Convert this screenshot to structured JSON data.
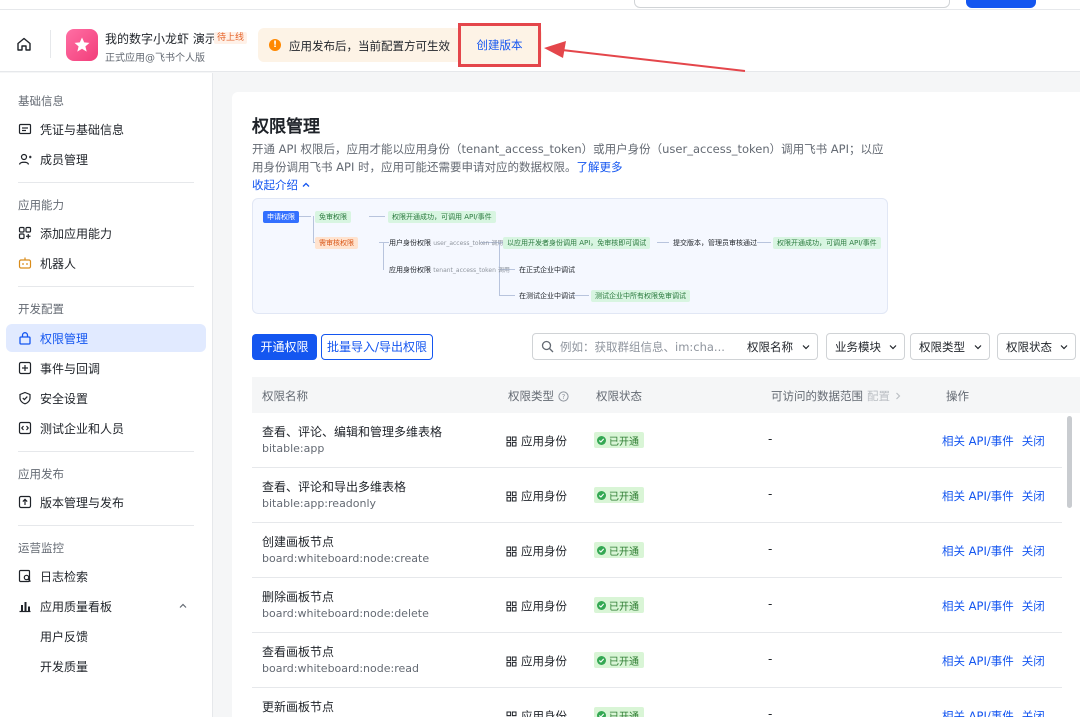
{
  "colors": {
    "accent": "#1456f0",
    "active_bg": "#e1eaff",
    "success": "#34a853",
    "warning": "#ff8800",
    "highlight": "#e4464b"
  },
  "app": {
    "name": "我的数字小龙虾 演示",
    "tag": "待上线",
    "subtitle": "正式应用@飞书个人版"
  },
  "notice": {
    "text": "应用发布后，当前配置方可生效",
    "action_label": "创建版本"
  },
  "sidebar": {
    "sections": [
      {
        "title": "基础信息",
        "items": [
          {
            "label": "凭证与基础信息",
            "icon": "credential-icon"
          },
          {
            "label": "成员管理",
            "icon": "member-icon"
          }
        ]
      },
      {
        "title": "应用能力",
        "items": [
          {
            "label": "添加应用能力",
            "icon": "grid-icon"
          },
          {
            "label": "机器人",
            "icon": "robot-icon"
          }
        ]
      },
      {
        "title": "开发配置",
        "items": [
          {
            "label": "权限管理",
            "icon": "lock-icon"
          },
          {
            "label": "事件与回调",
            "icon": "event-icon"
          },
          {
            "label": "安全设置",
            "icon": "shield-icon"
          },
          {
            "label": "测试企业和人员",
            "icon": "code-icon"
          }
        ]
      },
      {
        "title": "应用发布",
        "items": [
          {
            "label": "版本管理与发布",
            "icon": "upload-icon"
          }
        ]
      },
      {
        "title": "运营监控",
        "items": [
          {
            "label": "日志检索",
            "icon": "log-icon"
          },
          {
            "label": "应用质量看板",
            "icon": "chart-icon"
          },
          {
            "label": "用户反馈",
            "icon": ""
          },
          {
            "label": "开发质量",
            "icon": ""
          }
        ]
      }
    ],
    "active_item": "权限管理"
  },
  "main": {
    "title": "权限管理",
    "intro": "开通 API 权限后，应用才能以应用身份（tenant_access_token）或用户身份（user_access_token）调用飞书 API；以应用身份调用飞书 API 时，应用可能还需要申请对应的数据权限。",
    "learn_more": "了解更多",
    "collapse_label": "收起介绍",
    "diagram": {
      "apply": "申请权限",
      "no_review": "免审权限",
      "no_review_result": "权限开通成功，可调用 API/事件",
      "need_review": "需审核权限",
      "user_identity": "用户身份权限",
      "user_token": "user_access_token 调用",
      "dev_debug": "以应用开发者身份调用 API，免审核即可调试",
      "submit": "提交版本，管理员审核通过",
      "final_result": "权限开通成功，可调用 API/事件",
      "app_identity": "应用身份权限",
      "tenant_token": "tenant_access_token 调用",
      "formal_debug": "在正式企业中调试",
      "test_debug": "在测试企业中调试",
      "test_result": "测试企业中所有权限免审调试"
    },
    "toolbar": {
      "enable_btn": "开通权限",
      "batch_btn": "批量导入/导出权限",
      "search_placeholder": "例如：获取群组信息、im:cha...",
      "filters": [
        "权限名称",
        "业务模块",
        "权限类型",
        "权限状态"
      ]
    },
    "table": {
      "headers": {
        "name": "权限名称",
        "type": "权限类型",
        "status": "权限状态",
        "scope": "可访问的数据范围",
        "config": "配置",
        "ops": "操作"
      },
      "rows": [
        {
          "name": "查看、评论、编辑和管理多维表格",
          "code": "bitable:app",
          "type": "应用身份",
          "status": "已开通",
          "scope": "-",
          "op1": "相关 API/事件",
          "op2": "关闭"
        },
        {
          "name": "查看、评论和导出多维表格",
          "code": "bitable:app:readonly",
          "type": "应用身份",
          "status": "已开通",
          "scope": "-",
          "op1": "相关 API/事件",
          "op2": "关闭"
        },
        {
          "name": "创建画板节点",
          "code": "board:whiteboard:node:create",
          "type": "应用身份",
          "status": "已开通",
          "scope": "-",
          "op1": "相关 API/事件",
          "op2": "关闭"
        },
        {
          "name": "删除画板节点",
          "code": "board:whiteboard:node:delete",
          "type": "应用身份",
          "status": "已开通",
          "scope": "-",
          "op1": "相关 API/事件",
          "op2": "关闭"
        },
        {
          "name": "查看画板节点",
          "code": "board:whiteboard:node:read",
          "type": "应用身份",
          "status": "已开通",
          "scope": "-",
          "op1": "相关 API/事件",
          "op2": "关闭"
        },
        {
          "name": "更新画板节点",
          "code": "",
          "type": "应用身份",
          "status": "已开通",
          "scope": "-",
          "op1": "相关 API/事件",
          "op2": "关闭"
        }
      ]
    }
  }
}
